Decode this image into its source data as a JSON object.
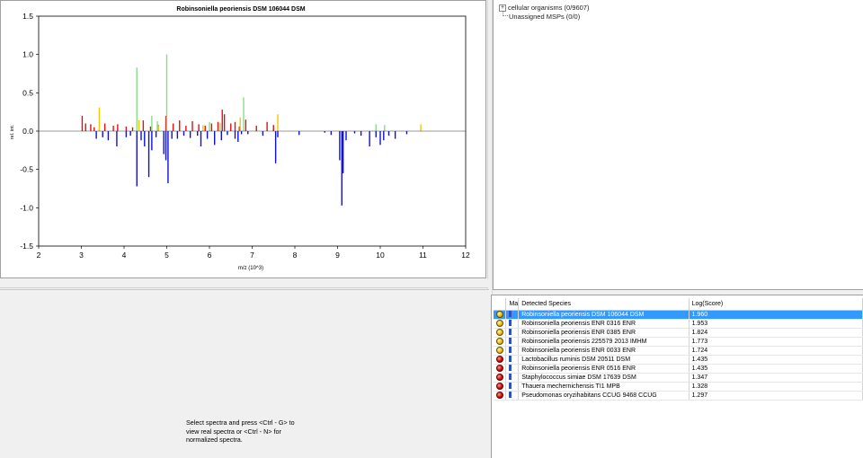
{
  "spectrum": {
    "title": "Robinsoniella peoriensis DSM 106044 DSM",
    "colors": {
      "red": "#dd1111",
      "yellow": "#f0c800",
      "green": "#88dd88",
      "blue": "#1010cc",
      "zero_line": "#333333"
    }
  },
  "chart_data": {
    "type": "bar",
    "title": "Robinsoniella peoriensis DSM 106044 DSM",
    "xlabel": "m/z (10^3)",
    "ylabel": "rel. int.",
    "xlim": [
      2,
      12
    ],
    "ylim": [
      -1.5,
      1.5
    ],
    "xticks": [
      "2",
      "3",
      "4",
      "5",
      "6",
      "7",
      "8",
      "9",
      "10",
      "11",
      "12"
    ],
    "yticks": [
      "1.5",
      "1.0",
      "0.5",
      "0.0",
      "-0.5",
      "-1.0",
      "-1.5"
    ],
    "grid": false,
    "series": [
      {
        "color": "red",
        "x": [
          3.02,
          3.1,
          3.22,
          3.3,
          3.55,
          3.75,
          3.85,
          4.05,
          4.2,
          4.45,
          4.62,
          4.8,
          4.98,
          5.15,
          5.3,
          5.45,
          5.6,
          5.75,
          5.9,
          6.05,
          6.2,
          6.3,
          6.35,
          6.5,
          6.6,
          6.7,
          6.85,
          7.1,
          7.35,
          7.5
        ],
        "y": [
          0.2,
          0.1,
          0.09,
          0.05,
          0.1,
          0.07,
          0.09,
          0.06,
          0.05,
          0.14,
          0.06,
          0.08,
          0.2,
          0.1,
          0.14,
          0.07,
          0.13,
          0.09,
          0.07,
          0.1,
          0.12,
          0.28,
          0.22,
          0.1,
          0.12,
          0.06,
          0.15,
          0.07,
          0.12,
          0.08
        ]
      },
      {
        "color": "yellow",
        "x": [
          3.42,
          4.35,
          4.8,
          5.85,
          6.72,
          7.6,
          10.95
        ],
        "y": [
          0.31,
          0.14,
          0.07,
          0.08,
          0.18,
          0.22,
          0.09
        ]
      },
      {
        "color": "green",
        "x": [
          4.3,
          4.65,
          4.78,
          5.0,
          6.0,
          6.25,
          6.8,
          9.9,
          10.1
        ],
        "y": [
          0.83,
          0.2,
          0.13,
          1.0,
          0.12,
          0.11,
          0.44,
          0.09,
          0.08
        ]
      },
      {
        "color": "blue",
        "x": [
          3.35,
          3.5,
          3.63,
          3.83,
          4.05,
          4.15,
          4.3,
          4.4,
          4.48,
          4.58,
          4.65,
          4.75,
          4.93,
          4.98,
          5.03,
          5.12,
          5.25,
          5.4,
          5.55,
          5.72,
          5.8,
          5.95,
          6.12,
          6.28,
          6.42,
          6.6,
          6.67,
          6.75,
          6.9,
          7.25,
          7.55,
          7.6,
          8.1,
          8.7,
          8.85,
          9.05,
          9.1,
          9.13,
          9.2,
          9.4,
          9.55,
          9.75,
          9.9,
          10.0,
          10.08,
          10.2,
          10.35,
          10.62
        ],
        "y": [
          -0.1,
          -0.08,
          -0.12,
          -0.2,
          -0.08,
          -0.06,
          -0.72,
          -0.12,
          -0.2,
          -0.6,
          -0.25,
          -0.08,
          -0.3,
          -0.38,
          -0.68,
          -0.1,
          -0.1,
          -0.06,
          -0.09,
          -0.06,
          -0.2,
          -0.1,
          -0.18,
          -0.12,
          -0.05,
          -0.1,
          -0.14,
          -0.04,
          -0.04,
          -0.06,
          -0.42,
          -0.08,
          -0.05,
          -0.02,
          -0.05,
          -0.38,
          -0.97,
          -0.55,
          -0.12,
          -0.03,
          -0.06,
          -0.2,
          -0.08,
          -0.18,
          -0.12,
          -0.06,
          -0.1,
          -0.04
        ]
      }
    ]
  },
  "tree": {
    "items": [
      {
        "label": "cellular organisms (0/9607)",
        "expander": "+"
      },
      {
        "label": "Unassigned MSPs (0/0)"
      }
    ]
  },
  "hint": {
    "text": "Select spectra and press <Ctrl - G> to\nview real spectra or <Ctrl - N> for\nnormalized spectra."
  },
  "results": {
    "columns": {
      "status": "",
      "info": "Ma",
      "species": "Detected Species",
      "score": "Log(Score)"
    },
    "rows": [
      {
        "status": "yellow",
        "species": "Robinsoniella peoriensis DSM 106044 DSM",
        "score": "1.960",
        "selected": true
      },
      {
        "status": "yellow",
        "species": "Robinsoniella peoriensis ENR  0316 ENR",
        "score": "1.953"
      },
      {
        "status": "yellow",
        "species": "Robinsoniella peoriensis ENR  0385 ENR",
        "score": "1.824"
      },
      {
        "status": "yellow",
        "species": "Robinsoniella peoriensis 225579  2013 IMHM",
        "score": "1.773"
      },
      {
        "status": "yellow",
        "species": "Robinsoniella peoriensis ENR  0033 ENR",
        "score": "1.724"
      },
      {
        "status": "red",
        "species": "Lactobacillus ruminis DSM 20511 DSM",
        "score": "1.435"
      },
      {
        "status": "red",
        "species": "Robinsoniella peoriensis ENR  0516 ENR",
        "score": "1.435"
      },
      {
        "status": "red",
        "species": "Staphylococcus simiae DSM 17639 DSM",
        "score": "1.347"
      },
      {
        "status": "red",
        "species": "Thauera mechernichensis TI1 MPB",
        "score": "1.328"
      },
      {
        "status": "red",
        "species": "Pseudomonas oryzihabitans CCUG 9468 CCUG",
        "score": "1.297"
      }
    ]
  }
}
